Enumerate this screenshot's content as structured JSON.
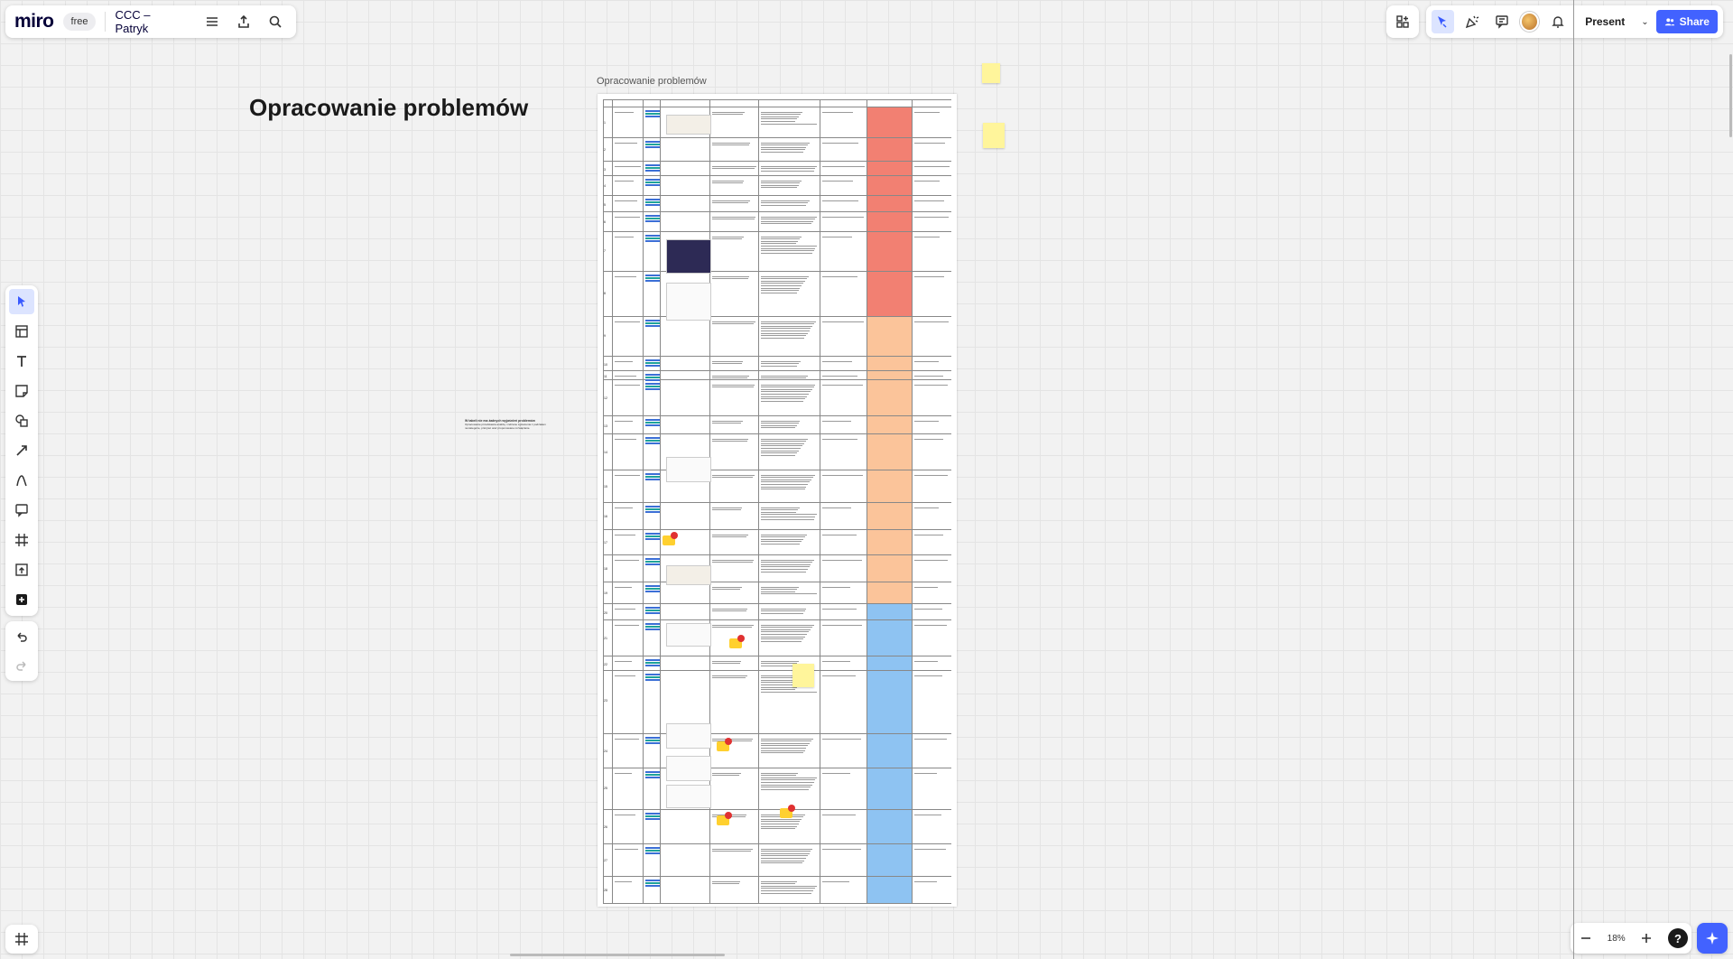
{
  "app": {
    "logo": "miro",
    "plan_badge": "free",
    "board_title": "CCC – Patryk"
  },
  "top_left_icons": [
    "menu-icon",
    "export-icon",
    "search-icon"
  ],
  "top_right": {
    "icons": [
      "apps-icon",
      "cursor-icon",
      "reactions-icon",
      "comments-icon",
      "notifications-icon"
    ],
    "present_label": "Present",
    "share_label": "Share"
  },
  "left_toolbar": {
    "tools": [
      "select-icon",
      "templates-icon",
      "text-icon",
      "sticky-note-icon",
      "shapes-icon",
      "pen-icon",
      "connector-icon",
      "comment-icon",
      "frame-icon",
      "upload-icon",
      "add-icon"
    ],
    "history": [
      "undo-icon",
      "redo-icon"
    ]
  },
  "canvas": {
    "heading": "Opracowanie problemów",
    "frame_label": "Opracowanie problemów",
    "side_note_title": "W tabeli nie ma żadnych wyjaśnień problemów",
    "side_note_body": "Opracowanie przedstawia analizę i zebrane zgłoszenia z podziałem na kategorie, priorytet oraz proponowane rozwiązanie."
  },
  "table": {
    "row_numbers": [
      "1",
      "2",
      "3",
      "4",
      "5",
      "6",
      "7",
      "8",
      "9",
      "10",
      "11",
      "12",
      "13",
      "14",
      "15",
      "16",
      "17",
      "18",
      "19",
      "20",
      "21",
      "22",
      "23",
      "24",
      "25",
      "26",
      "27",
      "28",
      "29",
      "30"
    ],
    "priority_colors": {
      "high": "#f28072",
      "medium": "#fbc49a",
      "low": "#8ec3f2"
    }
  },
  "zoom": {
    "value": "18%",
    "help": "?"
  },
  "colors": {
    "accent": "#4262ff",
    "sticky": "#fff59b",
    "comment": "#ffd02f"
  }
}
